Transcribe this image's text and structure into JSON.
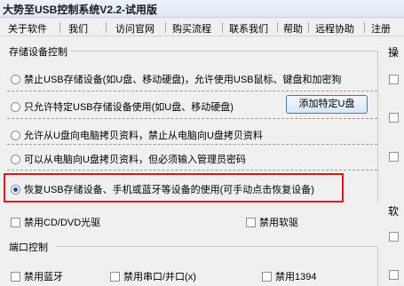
{
  "window": {
    "title": "大势至USB控制系统V2.2-试用版"
  },
  "menu": [
    "关于软件",
    "我们",
    "访问官网",
    "购买流程",
    "联系我们",
    "帮助",
    "远程协助",
    "注册"
  ],
  "storage_section": {
    "title": "存储设备控制",
    "options": [
      "禁止USB存储设备(如U盘、移动硬盘)，允许使用USB鼠标、键盘和加密狗",
      "只允许特定USB存储设备使用(如U盘、移动硬盘)",
      "允许从U盘向电脑拷贝资料，禁止从电脑向U盘拷贝资料",
      "可以从电脑向U盘拷贝资料，但必须输入管理员密码",
      "恢复USB存储设备、手机或蓝牙等设备的使用(可手动点击恢复设备)"
    ],
    "selected_index": 4,
    "add_button": "添加特定U盘",
    "cd_dvd": "禁用CD/DVD光驱",
    "floppy": "禁用软驱"
  },
  "port_section": {
    "title": "端口控制",
    "bluetooth": "禁用蓝牙",
    "serial_parallel": "禁用串口/并口(x)",
    "ieee1394": "禁用1394"
  },
  "right_panel": {
    "label_top": "操",
    "label_bottom": "软"
  },
  "highlight_color": "#e0141c"
}
